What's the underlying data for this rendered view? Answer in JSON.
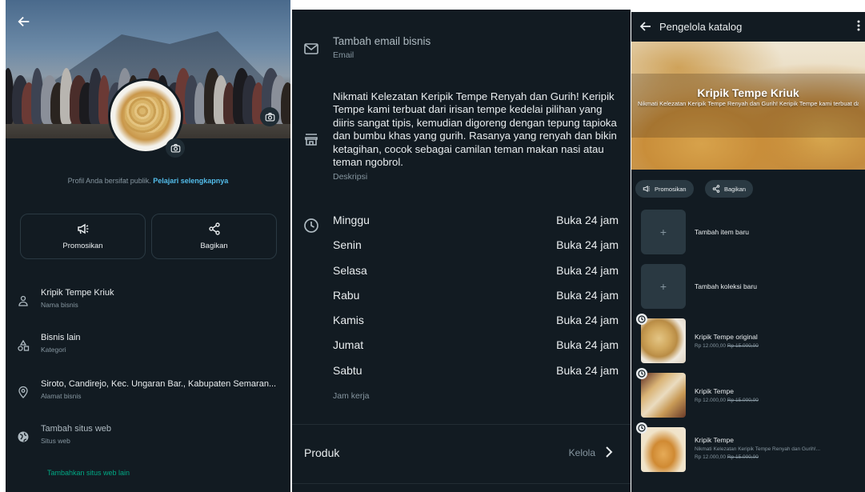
{
  "profile": {
    "public_note": "Profil Anda bersifat publik.",
    "public_link": "Pelajari selengkapnya",
    "actions": {
      "promote": "Promosikan",
      "share": "Bagikan"
    },
    "business_name": "Kripik Tempe Kriuk",
    "business_name_label": "Nama bisnis",
    "category": "Bisnis lain",
    "category_label": "Kategori",
    "address": "Siroto, Candirejo, Kec. Ungaran Bar., Kabupaten Semaran...",
    "address_label": "Alamat bisnis",
    "website": "Tambah situs web",
    "website_label": "Situs web",
    "add_website": "Tambahkan situs web lain"
  },
  "details": {
    "email": "Tambah email bisnis",
    "email_label": "Email",
    "description": "Nikmati Kelezatan Keripik Tempe Renyah dan Gurih! Keripik Tempe kami terbuat dari irisan tempe kedelai pilihan yang diiris sangat tipis, kemudian digoreng dengan tepung tapioka dan bumbu khas yang gurih. Rasanya yang renyah dan bikin ketagihan, cocok sebagai camilan teman makan nasi atau teman ngobrol.",
    "description_label": "Deskripsi",
    "hours": [
      {
        "day": "Minggu",
        "status": "Buka 24 jam"
      },
      {
        "day": "Senin",
        "status": "Buka 24 jam"
      },
      {
        "day": "Selasa",
        "status": "Buka 24 jam"
      },
      {
        "day": "Rabu",
        "status": "Buka 24 jam"
      },
      {
        "day": "Kamis",
        "status": "Buka 24 jam"
      },
      {
        "day": "Jumat",
        "status": "Buka 24 jam"
      },
      {
        "day": "Sabtu",
        "status": "Buka 24 jam"
      }
    ],
    "hours_label": "Jam kerja",
    "products_label": "Produk",
    "products_manage": "Kelola"
  },
  "catalog": {
    "title": "Pengelola katalog",
    "banner_title": "Kripik Tempe Kriuk",
    "banner_desc": "Nikmati Kelezatan Keripik Tempe Renyah dan Gurih! Keripik Tempe kami terbuat dari irisan tempe kedelai pilihan yang diiris sangat tipis, kemudian digoreng dengan...",
    "chips": {
      "promote": "Promosikan",
      "share": "Bagikan"
    },
    "add_item": "Tambah item baru",
    "add_collection": "Tambah koleksi baru",
    "products": [
      {
        "name": "Kripik Tempe original",
        "desc": "",
        "price": "Rp 12.000,00",
        "old_price": "Rp 15.000,00"
      },
      {
        "name": "Kripik Tempe",
        "desc": "",
        "price": "Rp 12.000,00",
        "old_price": "Rp 15.000,00"
      },
      {
        "name": "Kripik Tempe",
        "desc": "Nikmati Kelezatan Keripik Tempe Renyah dan Gurih!...",
        "price": "Rp 12.000,00",
        "old_price": "Rp 15.000,00"
      }
    ]
  },
  "colors": {
    "background": "#121b22",
    "accent": "#00a884",
    "link": "#53bdeb",
    "muted": "#8696a0"
  }
}
